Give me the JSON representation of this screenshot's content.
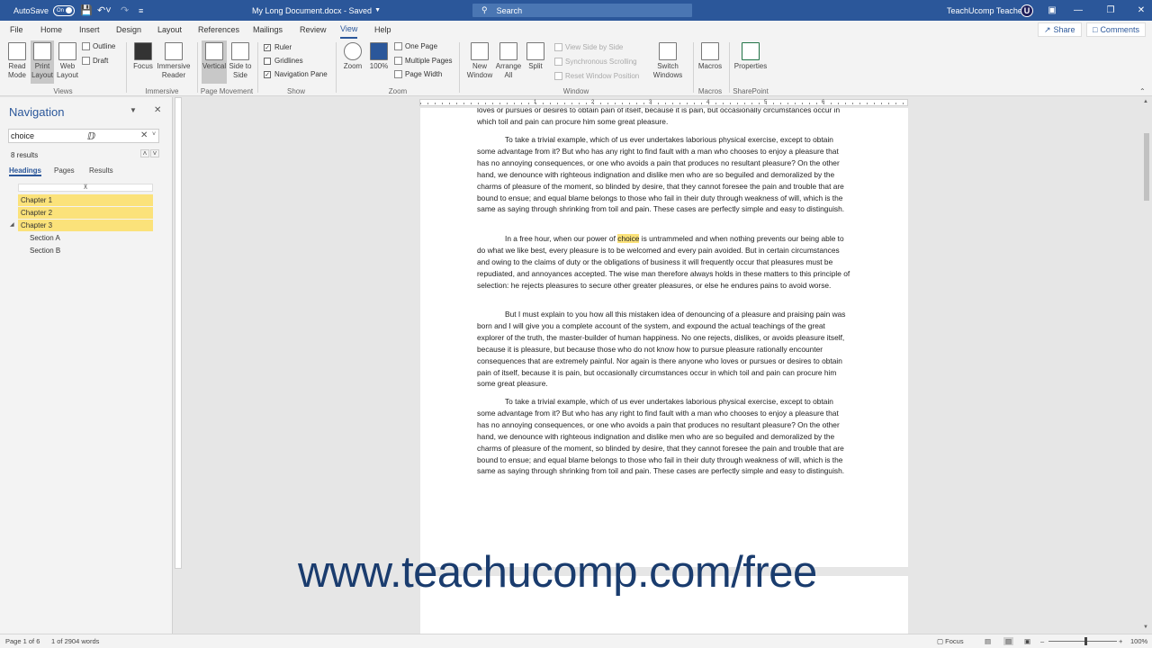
{
  "titlebar": {
    "autosave_label": "AutoSave",
    "autosave_state": "On",
    "doc_title": "My Long Document.docx - Saved",
    "search_placeholder": "Search",
    "user_name": "TeachUcomp Teacher",
    "user_initial": "U"
  },
  "menu": {
    "tabs": [
      "File",
      "Home",
      "Insert",
      "Design",
      "Layout",
      "References",
      "Mailings",
      "Review",
      "View",
      "Help"
    ],
    "active_tab": "View",
    "share_label": "Share",
    "comments_label": "Comments"
  },
  "ribbon": {
    "views": {
      "read_mode": "Read Mode",
      "print_layout": "Print Layout",
      "web_layout": "Web Layout",
      "outline": "Outline",
      "draft": "Draft",
      "group": "Views"
    },
    "immersive": {
      "focus": "Focus",
      "immersive_reader": "Immersive Reader",
      "group": "Immersive"
    },
    "page_movement": {
      "vertical": "Vertical",
      "side_to_side": "Side to Side",
      "group": "Page Movement"
    },
    "show": {
      "ruler": "Ruler",
      "gridlines": "Gridlines",
      "navigation_pane": "Navigation Pane",
      "group": "Show"
    },
    "zoom": {
      "zoom": "Zoom",
      "hundred": "100%",
      "one_page": "One Page",
      "multiple_pages": "Multiple Pages",
      "page_width": "Page Width",
      "group": "Zoom"
    },
    "window": {
      "new_window": "New Window",
      "arrange_all": "Arrange All",
      "split": "Split",
      "view_side": "View Side by Side",
      "sync_scroll": "Synchronous Scrolling",
      "reset_pos": "Reset Window Position",
      "switch_windows": "Switch Windows",
      "group": "Window"
    },
    "macros": {
      "macros": "Macros",
      "group": "Macros"
    },
    "sharepoint": {
      "properties": "Properties",
      "group": "SharePoint"
    }
  },
  "nav": {
    "title": "Navigation",
    "search_value": "choice",
    "results_count": "8 results",
    "tabs": [
      "Headings",
      "Pages",
      "Results"
    ],
    "headings": [
      {
        "label": "Chapter 1",
        "highlight": true,
        "level": 1
      },
      {
        "label": "Chapter 2",
        "highlight": true,
        "level": 1
      },
      {
        "label": "Chapter 3",
        "highlight": true,
        "level": 1
      },
      {
        "label": "Section A",
        "highlight": false,
        "level": 2
      },
      {
        "label": "Section B",
        "highlight": false,
        "level": 2
      }
    ]
  },
  "ruler_numbers": [
    "1",
    "2",
    "3",
    "4",
    "5",
    "6"
  ],
  "document": {
    "p0": "loves or pursues or desires to obtain pain of itself, because it is pain, but occasionally circumstances occur in which toil and pain can procure him some great pleasure.",
    "p1": "To take a trivial example, which of us ever undertakes laborious physical exercise, except to obtain some advantage from it? But who has any right to find fault with a man who chooses to enjoy a pleasure that has no annoying consequences, or one who avoids a pain that produces no resultant pleasure? On the other hand, we denounce with righteous indignation and dislike men who are so beguiled and demoralized by the charms of pleasure of the moment, so blinded by desire, that they cannot foresee the pain and trouble that are bound to ensue; and equal blame belongs to those who fail in their duty through weakness of will, which is the same as saying through shrinking from toil and pain. These cases are perfectly simple and easy to distinguish.",
    "p2_before": "In a free hour, when our power of ",
    "p2_match": "choice",
    "p2_after": " is untrammeled and when nothing prevents our being able to do what we like best, every pleasure is to be welcomed and every pain avoided. But in certain circumstances and owing to the claims of duty or the obligations of business it will frequently occur that pleasures must be repudiated, and annoyances accepted. The wise man therefore always holds in these matters to this principle of selection: he rejects pleasures to secure other greater pleasures, or else he endures pains to avoid worse.",
    "p3": "But I must explain to you how all this mistaken idea of denouncing of a pleasure and praising pain was born and I will give you a complete account of the system, and expound the actual teachings of the great explorer of the truth, the master-builder of human happiness. No one rejects, dislikes, or avoids pleasure itself, because it is pleasure, but because those who do not know how to pursue pleasure rationally encounter consequences that are extremely painful. Nor again is there anyone who loves or pursues or desires to obtain pain of itself, because it is pain, but occasionally circumstances occur in which toil and pain can procure him some great pleasure.",
    "p4": "To take a trivial example, which of us ever undertakes laborious physical exercise, except to obtain some advantage from it? But who has any right to find fault with a man who chooses to enjoy a pleasure that has no annoying consequences, or one who avoids a pain that produces no resultant pleasure? On the other hand, we denounce with righteous indignation and dislike men who are so beguiled and demoralized by the charms of pleasure of the moment, so blinded by desire, that they cannot foresee the pain and trouble that are bound to ensue; and equal blame belongs to those who fail in their duty through weakness of will, which is the same as saying through shrinking from toil and pain. These cases are perfectly simple and easy to distinguish."
  },
  "status": {
    "page": "Page 1 of 6",
    "words": "1 of 2904 words",
    "focus": "Focus",
    "zoom": "100%"
  },
  "watermark": "www.teachucomp.com/free"
}
